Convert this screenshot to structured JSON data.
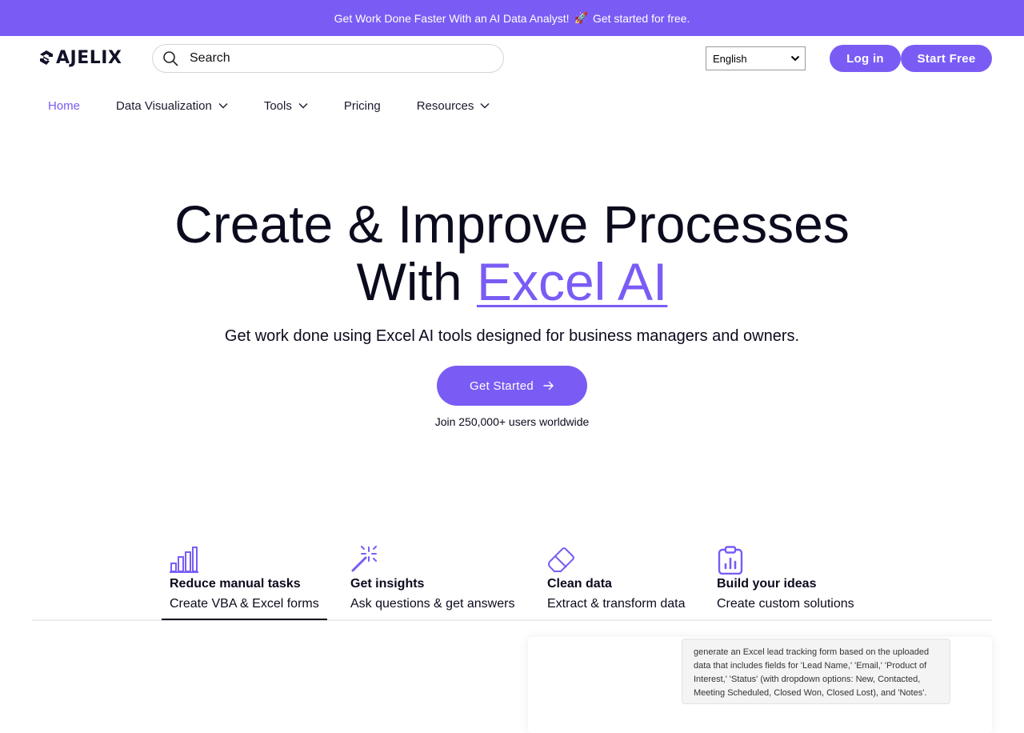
{
  "banner": {
    "text": "Get Work Done Faster With an AI Data Analyst!",
    "emoji": "🚀",
    "cta": "Get started for free."
  },
  "header": {
    "logo_text": "AJELIX",
    "search_placeholder": "Search",
    "language": "English",
    "login_label": "Log in",
    "start_free_label": "Start Free"
  },
  "nav": {
    "items": [
      {
        "label": "Home",
        "has_dropdown": false
      },
      {
        "label": "Data Visualization",
        "has_dropdown": true
      },
      {
        "label": "Tools",
        "has_dropdown": true
      },
      {
        "label": "Pricing",
        "has_dropdown": false
      },
      {
        "label": "Resources",
        "has_dropdown": true
      }
    ]
  },
  "hero": {
    "title_line1": "Create & Improve Processes",
    "title_line2_prefix": "With ",
    "title_accent": "Excel AI",
    "subtitle": "Get work done using Excel AI tools designed for business managers and owners.",
    "cta_label": "Get Started",
    "users_text": "Join 250,000+ users worldwide"
  },
  "features": [
    {
      "icon": "bar-chart-icon",
      "title": "Reduce manual tasks",
      "desc": "Create VBA & Excel forms"
    },
    {
      "icon": "magic-wand-icon",
      "title": "Get insights",
      "desc": "Ask questions & get answers"
    },
    {
      "icon": "eraser-icon",
      "title": "Clean data",
      "desc": "Extract & transform data"
    },
    {
      "icon": "clipboard-chart-icon",
      "title": "Build your ideas",
      "desc": "Create custom solutions"
    }
  ],
  "preview": {
    "prompt_text": "generate an Excel lead tracking form based on the uploaded data that includes fields for 'Lead Name,' 'Email,' 'Product of Interest,' 'Status' (with dropdown options: New, Contacted, Meeting Scheduled, Closed Won, Closed Lost), and 'Notes'."
  },
  "colors": {
    "accent": "#7a5cf5",
    "text": "#0b0b1e"
  }
}
